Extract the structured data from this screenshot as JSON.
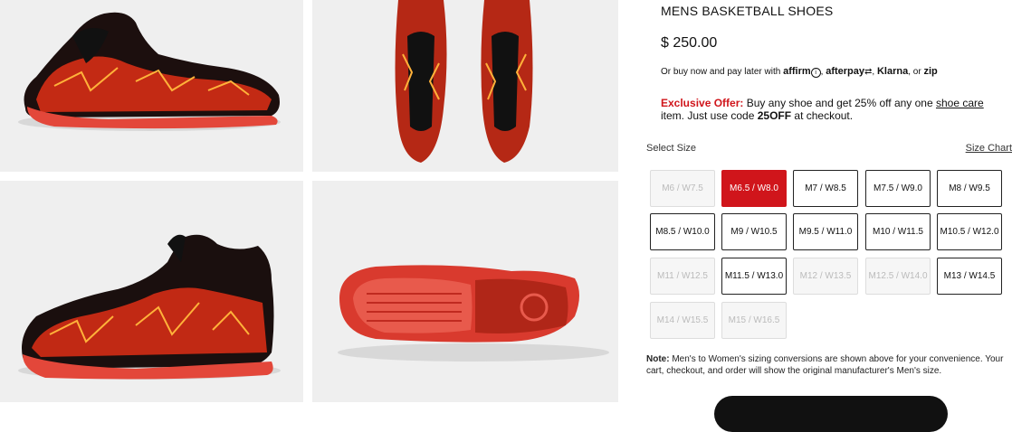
{
  "gallery": {
    "images": [
      {
        "alt": "Side view of red lightning-pattern foamposite shoe",
        "icon": "shoe-side-image"
      },
      {
        "alt": "Top-down view of pair of shoes",
        "icon": "shoe-top-image"
      },
      {
        "alt": "Medial side view of shoe",
        "icon": "shoe-medial-image"
      },
      {
        "alt": "Outsole view of shoe",
        "icon": "shoe-outsole-image"
      }
    ]
  },
  "product": {
    "category": "MENS BASKETBALL SHOES",
    "price": "$ 250.00",
    "pay_later": {
      "prefix": "Or buy now and pay later with",
      "providers": [
        "affirm",
        "afterpay",
        "Klarna",
        "zip"
      ],
      "sep1": ",",
      "sep2": ",",
      "or": ", or"
    },
    "offer": {
      "label": "Exclusive Offer:",
      "text1": " Buy any shoe and get 25% off any one ",
      "link": "shoe care",
      "text2": " item. Just use code ",
      "code": "25OFF",
      "text3": " at checkout."
    }
  },
  "size_picker": {
    "label": "Select Size",
    "chart_link": "Size Chart",
    "sizes": [
      {
        "label": "M6 / W7.5",
        "state": "disabled"
      },
      {
        "label": "M6.5 / W8.0",
        "state": "selected"
      },
      {
        "label": "M7 / W8.5",
        "state": "available"
      },
      {
        "label": "M7.5 / W9.0",
        "state": "available"
      },
      {
        "label": "M8 / W9.5",
        "state": "available"
      },
      {
        "label": "M8.5 / W10.0",
        "state": "available"
      },
      {
        "label": "M9 / W10.5",
        "state": "available"
      },
      {
        "label": "M9.5 / W11.0",
        "state": "available"
      },
      {
        "label": "M10 / W11.5",
        "state": "available"
      },
      {
        "label": "M10.5 / W12.0",
        "state": "available"
      },
      {
        "label": "M11 / W12.5",
        "state": "disabled"
      },
      {
        "label": "M11.5 / W13.0",
        "state": "available"
      },
      {
        "label": "M12 / W13.5",
        "state": "disabled"
      },
      {
        "label": "M12.5 / W14.0",
        "state": "disabled"
      },
      {
        "label": "M13 / W14.5",
        "state": "available"
      },
      {
        "label": "M14 / W15.5",
        "state": "disabled"
      },
      {
        "label": "M15 / W16.5",
        "state": "disabled"
      }
    ]
  },
  "note": {
    "label": "Note:",
    "text": " Men's to Women's sizing conversions are shown above for your convenience. Your cart, checkout, and order will show the original manufacturer's Men's size."
  },
  "colors": {
    "accent": "#d0151b",
    "tile_bg": "#efefef"
  }
}
